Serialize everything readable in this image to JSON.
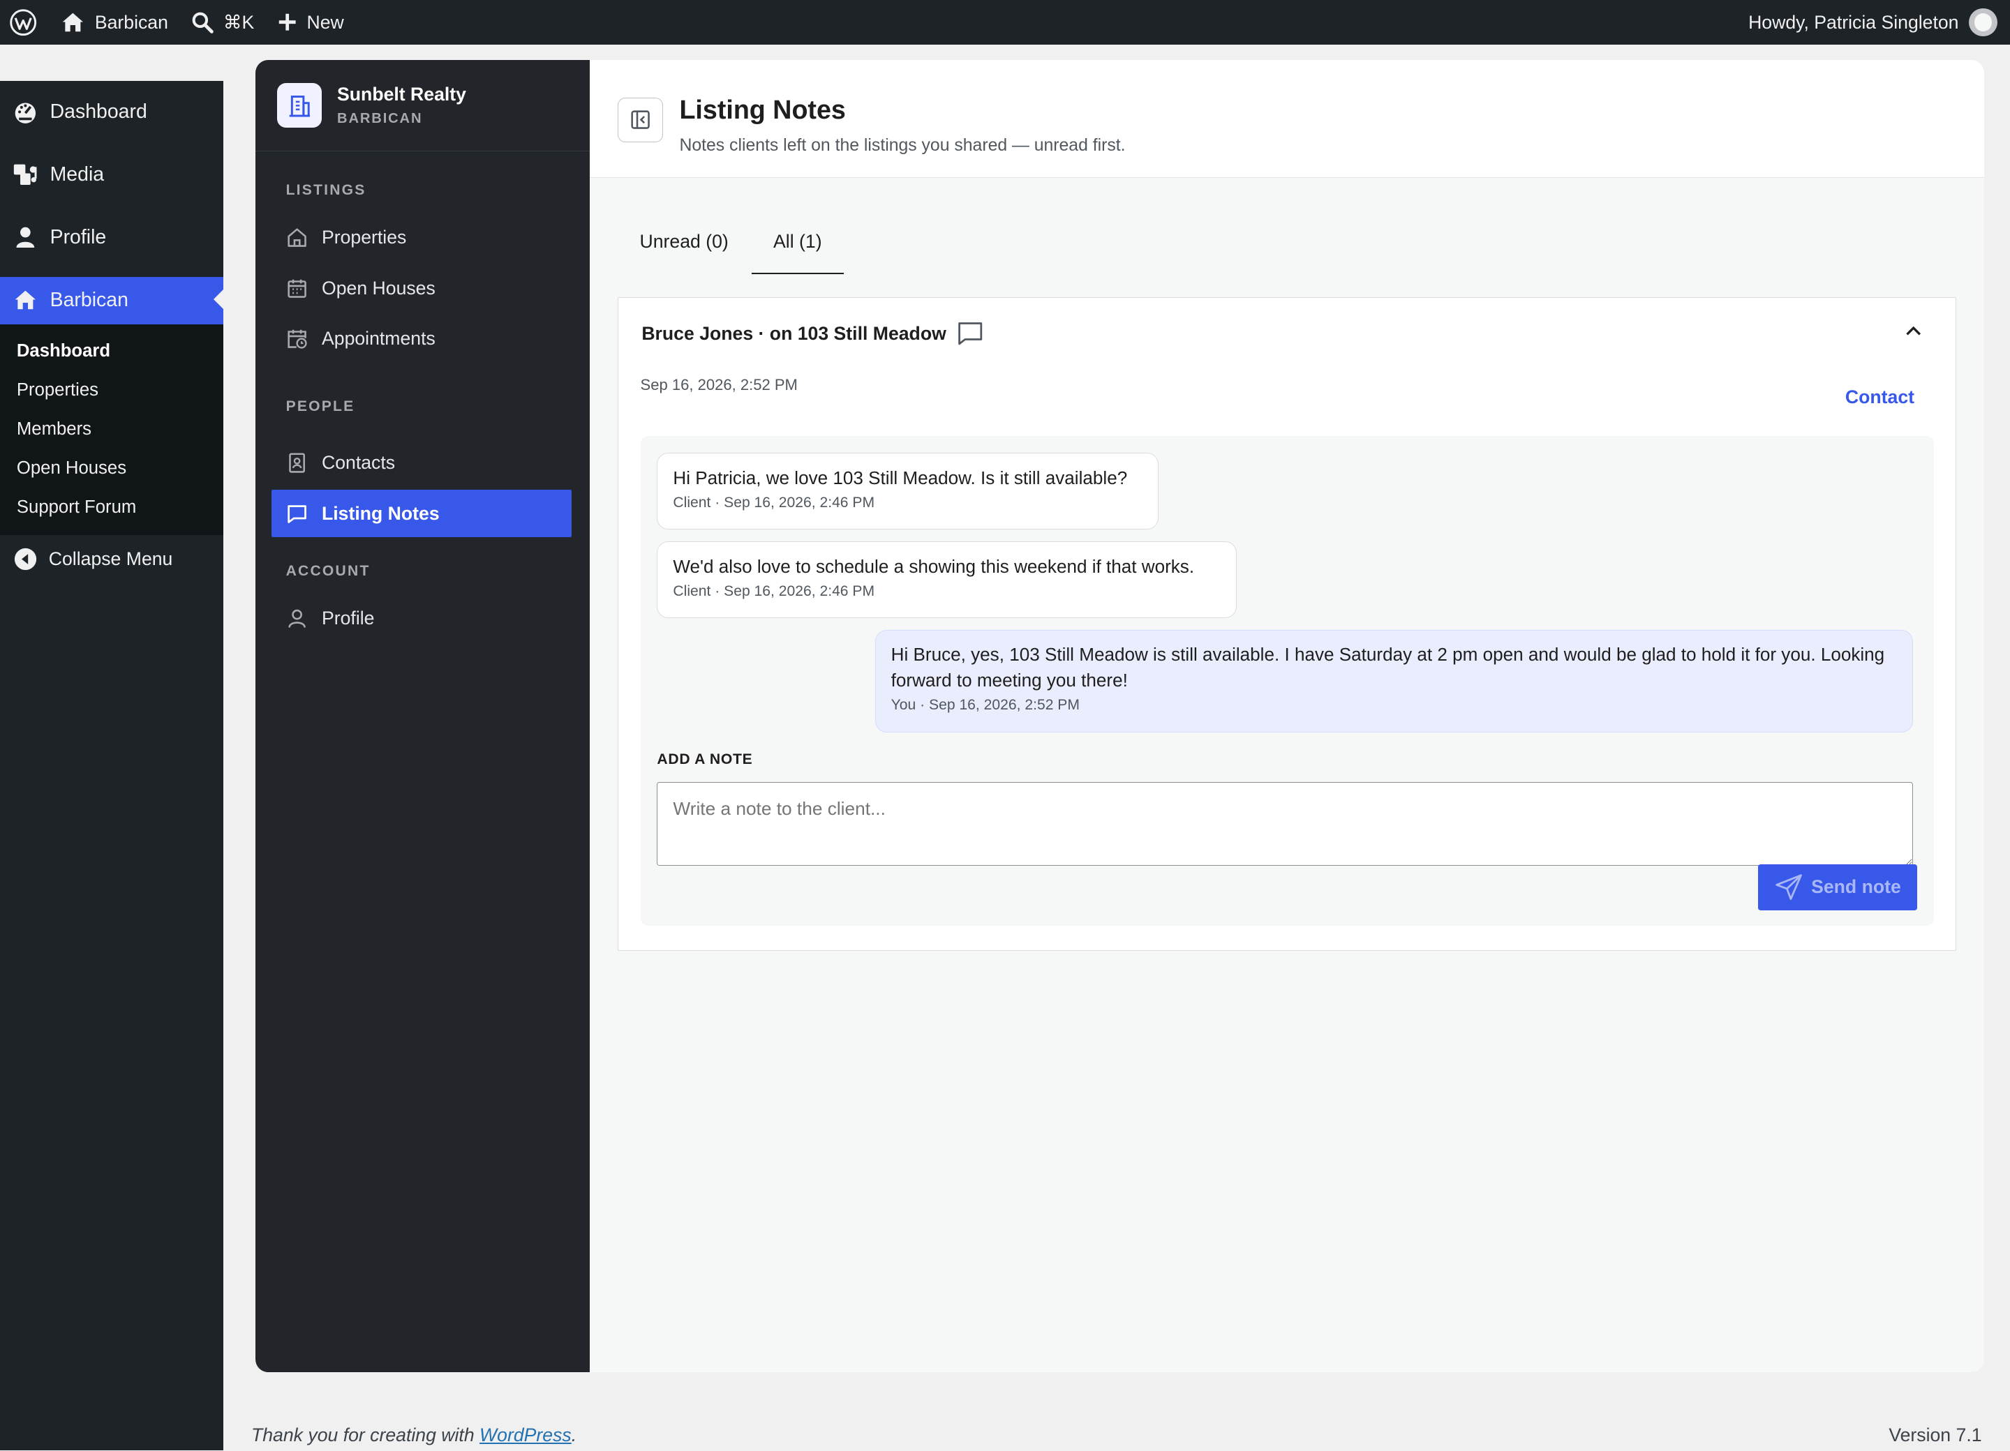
{
  "adminbar": {
    "site_name": "Barbican",
    "search_shortcut": "⌘K",
    "new_label": "New",
    "greeting": "Howdy, Patricia Singleton"
  },
  "admin_menu": {
    "items": [
      {
        "label": "Dashboard",
        "icon": "dashboard-icon"
      },
      {
        "label": "Media",
        "icon": "media-icon"
      },
      {
        "label": "Profile",
        "icon": "profile-icon"
      },
      {
        "label": "Barbican",
        "icon": "home-icon"
      }
    ],
    "submenu": [
      "Dashboard",
      "Properties",
      "Members",
      "Open Houses",
      "Support Forum"
    ],
    "collapse_label": "Collapse Menu"
  },
  "app_sidebar": {
    "brand_name": "Sunbelt Realty",
    "brand_sub": "BARBICAN",
    "sections": [
      {
        "title": "LISTINGS",
        "items": [
          {
            "label": "Properties",
            "icon": "home-outline-icon"
          },
          {
            "label": "Open Houses",
            "icon": "calendar-icon"
          },
          {
            "label": "Appointments",
            "icon": "calendar-clock-icon"
          }
        ]
      },
      {
        "title": "PEOPLE",
        "items": [
          {
            "label": "Contacts",
            "icon": "contact-card-icon"
          },
          {
            "label": "Listing Notes",
            "icon": "chat-bubble-icon",
            "active": true
          }
        ]
      },
      {
        "title": "ACCOUNT",
        "items": [
          {
            "label": "Profile",
            "icon": "user-outline-icon"
          }
        ]
      }
    ]
  },
  "header": {
    "title": "Listing Notes",
    "subtitle": "Notes clients left on the listings you shared — unread first."
  },
  "tabs": [
    {
      "label": "Unread (0)",
      "active": false
    },
    {
      "label": "All (1)",
      "active": true
    }
  ],
  "thread": {
    "title": "Bruce Jones · on 103 Still Meadow",
    "date": "Sep 16, 2026, 2:52 PM",
    "contact_label": "Contact",
    "messages": [
      {
        "text": "Hi Patricia, we love 103 Still Meadow. Is it still available?",
        "meta": "Client · Sep 16, 2026, 2:46 PM",
        "from": "client"
      },
      {
        "text": "We'd also love to schedule a showing this weekend if that works.",
        "meta": "Client · Sep 16, 2026, 2:46 PM",
        "from": "client"
      },
      {
        "text": "Hi Bruce, yes, 103 Still Meadow is still available. I have Saturday at 2 pm open and would be glad to hold it for you. Looking forward to meeting you there!",
        "meta": "You · Sep 16, 2026, 2:52 PM",
        "from": "you"
      }
    ],
    "add_note_label": "ADD A NOTE",
    "note_placeholder": "Write a note to the client...",
    "send_label": "Send note"
  },
  "footer": {
    "thanks_prefix": "Thank you for creating with ",
    "thanks_link": "WordPress",
    "thanks_suffix": ".",
    "version": "Version 7.1"
  },
  "colors": {
    "accent": "#3858e9",
    "admin_dark": "#1d2327",
    "app_sidebar": "#22262b",
    "mine_bubble": "#e9edfd"
  }
}
